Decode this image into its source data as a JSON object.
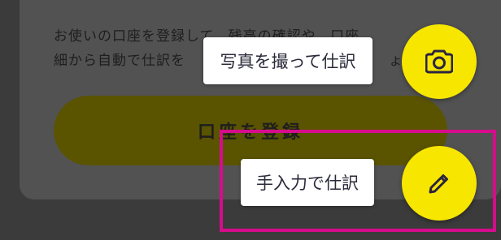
{
  "card": {
    "description_line1": "お使いの口座を登録して、残高の確認や、口座",
    "description_line2": "細から自動で仕訳を",
    "description_line2_tail": "ょう。",
    "register_button_label": "口座を登録"
  },
  "speed_dial": {
    "photo_action_label": "写真を撮って仕訳",
    "manual_action_label": "手入力で仕訳",
    "photo_icon": "camera-icon",
    "manual_icon": "pencil-icon"
  },
  "colors": {
    "fab": "#f7e600",
    "highlight": "#d60c8c",
    "scrim": "#3b3b3b"
  }
}
